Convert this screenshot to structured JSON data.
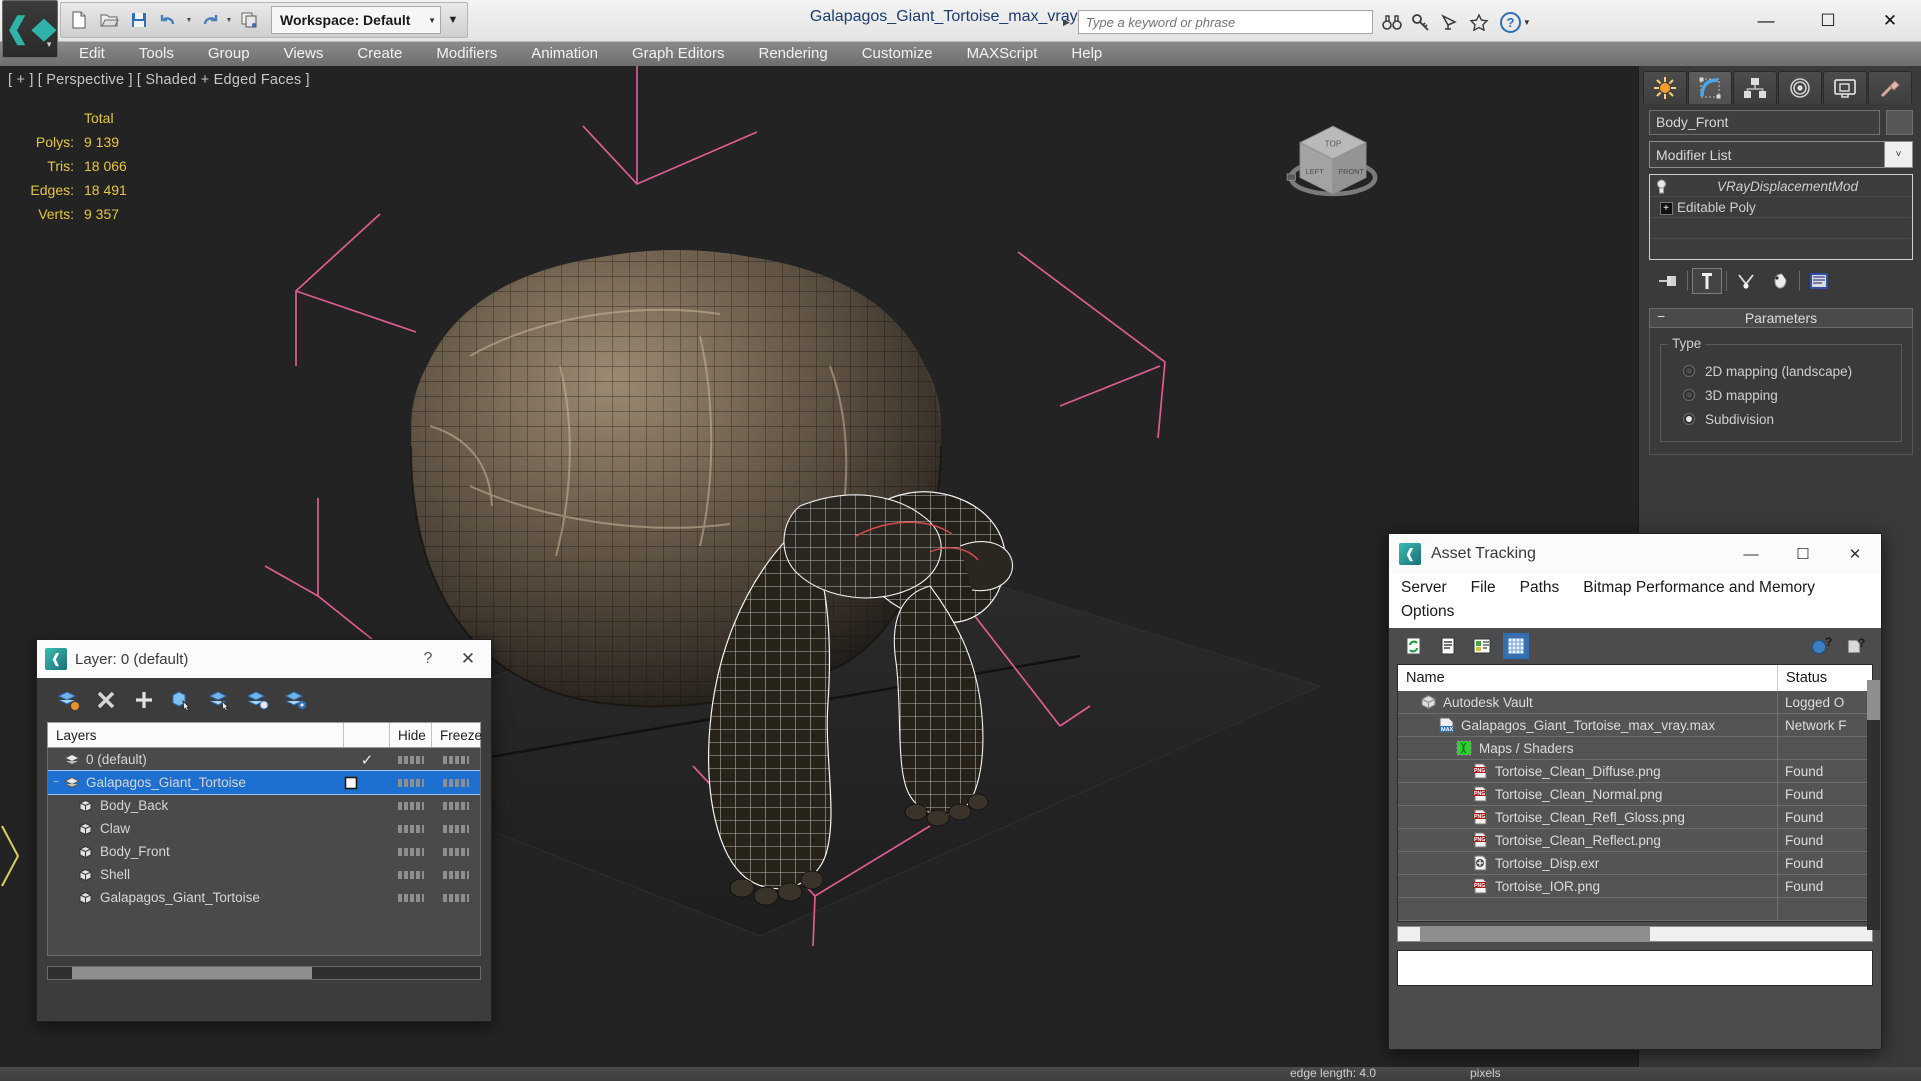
{
  "app": {
    "document_title": "Galapagos_Giant_Tortoise_max_vray.max",
    "logo_label": "max-logo"
  },
  "quick_access": {
    "workspace_label": "Workspace: Default",
    "buttons": [
      {
        "name": "new-file-icon",
        "label": "New"
      },
      {
        "name": "open-file-icon",
        "label": "Open"
      },
      {
        "name": "save-file-icon",
        "label": "Save"
      },
      {
        "name": "undo-icon",
        "label": "Undo"
      },
      {
        "name": "redo-icon",
        "label": "Redo"
      },
      {
        "name": "project-folder-icon",
        "label": "Set Project Folder"
      }
    ]
  },
  "search": {
    "placeholder": "Type a keyword or phrase",
    "icons": [
      "binoculars-icon",
      "key-icon",
      "satellite-dish-icon",
      "star-icon"
    ],
    "help_label": "?"
  },
  "window_controls": {
    "minimize": "—",
    "maximize": "☐",
    "close": "✕"
  },
  "menubar": {
    "items": [
      "Edit",
      "Tools",
      "Group",
      "Views",
      "Create",
      "Modifiers",
      "Animation",
      "Graph Editors",
      "Rendering",
      "Customize",
      "MAXScript",
      "Help"
    ]
  },
  "viewport": {
    "label": "[ + ] [ Perspective ] [ Shaded + Edged Faces ]",
    "stats_header": "Total",
    "stats": [
      {
        "key": "Polys:",
        "value": "9 139"
      },
      {
        "key": "Tris:",
        "value": "18 066"
      },
      {
        "key": "Edges:",
        "value": "18 491"
      },
      {
        "key": "Verts:",
        "value": "9 357"
      }
    ],
    "viewcube": {
      "top": "TOP",
      "left": "LEFT",
      "front": "FRONT"
    },
    "background_color": "#232323",
    "helper_line_color": "#e8609a",
    "stats_color": "#e3c73d"
  },
  "command_panel": {
    "tabs": [
      {
        "name": "create-tab",
        "label": "Create"
      },
      {
        "name": "modify-tab",
        "label": "Modify"
      },
      {
        "name": "hierarchy-tab",
        "label": "Hierarchy"
      },
      {
        "name": "motion-tab",
        "label": "Motion"
      },
      {
        "name": "display-tab",
        "label": "Display"
      },
      {
        "name": "utilities-tab",
        "label": "Utilities"
      }
    ],
    "active_tab": "Modify",
    "object_name": "Body_Front",
    "modifier_list_label": "Modifier List",
    "stack": [
      {
        "label": "VRayDisplacementMod",
        "italic": true,
        "icon": "lightbulb-icon"
      },
      {
        "label": "Editable Poly",
        "italic": false,
        "icon": "plus-box-icon"
      }
    ],
    "stack_buttons": [
      {
        "name": "pin-stack-button",
        "label": "Pin Stack"
      },
      {
        "name": "show-end-result-button",
        "label": "Show End Result"
      },
      {
        "name": "make-unique-button",
        "label": "Make Unique"
      },
      {
        "name": "remove-modifier-button",
        "label": "Remove Modifier"
      },
      {
        "name": "configure-modifier-sets-button",
        "label": "Configure Modifier Sets"
      }
    ],
    "rollout": {
      "title": "Parameters",
      "collapse_glyph": "−",
      "group_title": "Type",
      "options": [
        {
          "label": "2D mapping (landscape)",
          "selected": false
        },
        {
          "label": "3D mapping",
          "selected": false
        },
        {
          "label": "Subdivision",
          "selected": true
        }
      ]
    }
  },
  "layer_dialog": {
    "title": "Layer: 0 (default)",
    "help_glyph": "?",
    "close_glyph": "✕",
    "toolbar": [
      {
        "name": "create-new-layer-icon",
        "label": "Create New Layer"
      },
      {
        "name": "delete-layer-icon",
        "label": "Delete Highlighted Empty Layers"
      },
      {
        "name": "add-selection-icon",
        "label": "Add Selected Objects to Highlighted Layer"
      },
      {
        "name": "select-object-layer-icon",
        "label": "Select Object's Layer"
      },
      {
        "name": "highlight-selected-icon",
        "label": "Highlight Selected Objects' Layers"
      },
      {
        "name": "set-current-layer-icon",
        "label": "Set Current Layer to Selection's Layer"
      },
      {
        "name": "layer-settings-icon",
        "label": "Layer Settings"
      }
    ],
    "columns": [
      "Layers",
      "",
      "Hide",
      "Freeze"
    ],
    "rows": [
      {
        "name": "0 (default)",
        "indent": 0,
        "expander": "",
        "current": true,
        "selected": false,
        "icon": "layer-icon"
      },
      {
        "name": "Galapagos_Giant_Tortoise",
        "indent": 0,
        "expander": "−",
        "current": false,
        "selected": true,
        "icon": "layer-icon"
      },
      {
        "name": "Body_Back",
        "indent": 1,
        "expander": "",
        "current": false,
        "selected": false,
        "icon": "object-icon"
      },
      {
        "name": "Claw",
        "indent": 1,
        "expander": "",
        "current": false,
        "selected": false,
        "icon": "object-icon"
      },
      {
        "name": "Body_Front",
        "indent": 1,
        "expander": "",
        "current": false,
        "selected": false,
        "icon": "object-icon"
      },
      {
        "name": "Shell",
        "indent": 1,
        "expander": "",
        "current": false,
        "selected": false,
        "icon": "object-icon"
      },
      {
        "name": "Galapagos_Giant_Tortoise",
        "indent": 1,
        "expander": "",
        "current": false,
        "selected": false,
        "icon": "object-icon"
      }
    ]
  },
  "asset_tracking": {
    "title": "Asset Tracking",
    "window_controls": {
      "minimize": "—",
      "maximize": "☐",
      "close": "✕"
    },
    "menu": [
      "Server",
      "File",
      "Paths",
      "Bitmap Performance and Memory",
      "Options"
    ],
    "toolbar": [
      {
        "name": "refresh-icon",
        "label": "Refresh"
      },
      {
        "name": "list-view-icon",
        "label": "List View"
      },
      {
        "name": "detail-view-icon",
        "label": "Detail View"
      },
      {
        "name": "grid-view-icon",
        "label": "Grid View",
        "selected": true
      },
      {
        "name": "help-new-icon",
        "label": "Help"
      },
      {
        "name": "help-icon",
        "label": "Help Topics"
      }
    ],
    "columns": [
      "Name",
      "Status"
    ],
    "rows": [
      {
        "name": "Autodesk Vault",
        "status": "Logged O",
        "indent": 0,
        "icon": "vault-icon"
      },
      {
        "name": "Galapagos_Giant_Tortoise_max_vray.max",
        "status": "Network F",
        "indent": 1,
        "icon": "max-file-icon"
      },
      {
        "name": "Maps / Shaders",
        "status": "",
        "indent": 2,
        "icon": "maps-shaders-icon"
      },
      {
        "name": "Tortoise_Clean_Diffuse.png",
        "status": "Found",
        "indent": 3,
        "icon": "png-icon"
      },
      {
        "name": "Tortoise_Clean_Normal.png",
        "status": "Found",
        "indent": 3,
        "icon": "png-icon"
      },
      {
        "name": "Tortoise_Clean_Refl_Gloss.png",
        "status": "Found",
        "indent": 3,
        "icon": "png-icon"
      },
      {
        "name": "Tortoise_Clean_Reflect.png",
        "status": "Found",
        "indent": 3,
        "icon": "png-icon"
      },
      {
        "name": "Tortoise_Disp.exr",
        "status": "Found",
        "indent": 3,
        "icon": "exr-icon"
      },
      {
        "name": "Tortoise_IOR.png",
        "status": "Found",
        "indent": 3,
        "icon": "png-icon"
      }
    ]
  },
  "statusbar": {
    "edge_length_label": "edge length: 4.0",
    "units_label": "pixels"
  }
}
